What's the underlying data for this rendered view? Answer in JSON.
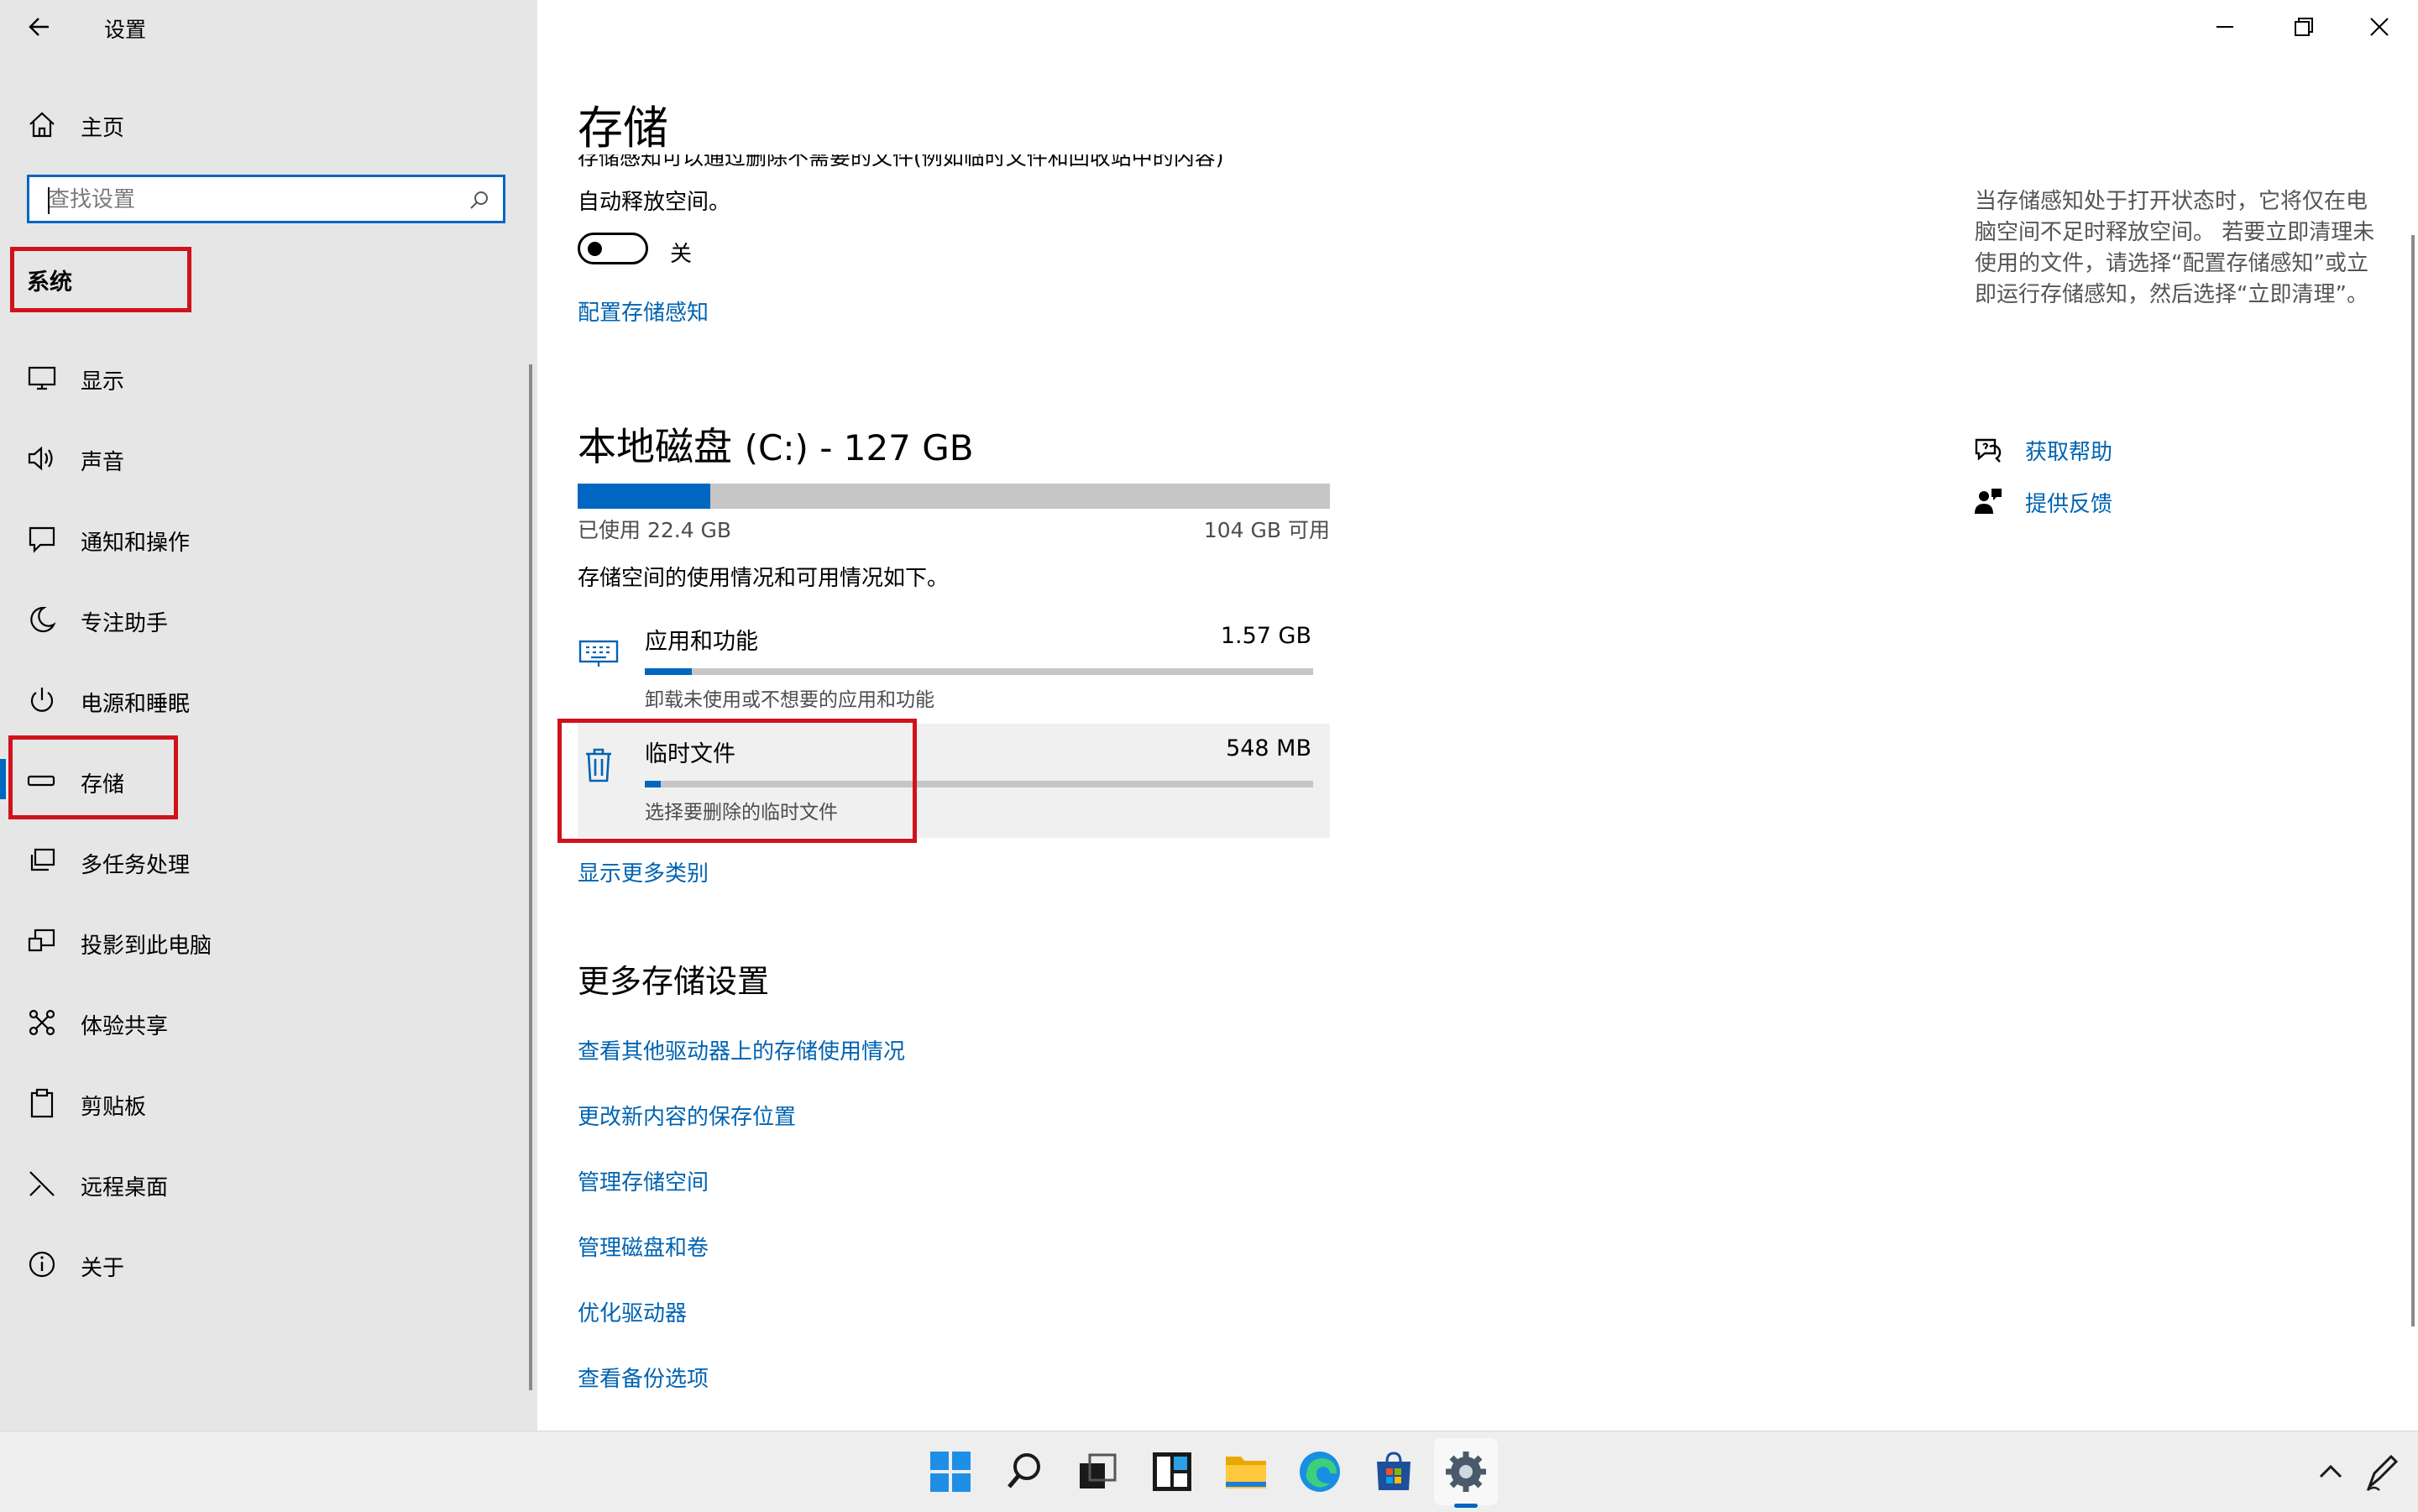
{
  "app_title": "设置",
  "home_label": "主页",
  "search": {
    "placeholder": "查找设置"
  },
  "section_header": "系统",
  "nav_items": [
    {
      "label": "显示",
      "icon": "monitor-icon"
    },
    {
      "label": "声音",
      "icon": "speaker-icon"
    },
    {
      "label": "通知和操作",
      "icon": "notification-icon"
    },
    {
      "label": "专注助手",
      "icon": "moon-icon"
    },
    {
      "label": "电源和睡眠",
      "icon": "power-icon"
    },
    {
      "label": "存储",
      "icon": "storage-icon"
    },
    {
      "label": "多任务处理",
      "icon": "multitask-icon"
    },
    {
      "label": "投影到此电脑",
      "icon": "project-icon"
    },
    {
      "label": "体验共享",
      "icon": "share-icon"
    },
    {
      "label": "剪贴板",
      "icon": "clipboard-icon"
    },
    {
      "label": "远程桌面",
      "icon": "remote-icon"
    },
    {
      "label": "关于",
      "icon": "info-icon"
    }
  ],
  "main": {
    "title": "存储",
    "cut_text": "存储感知可以通过删除不需要的文件(例如临时文件和回收站中的内容)",
    "auto_free": "自动释放空间。",
    "toggle_label": "关",
    "toggle_on": false,
    "configure_link": "配置存储感知",
    "disk": {
      "title": "本地磁盘",
      "title_suffix": "(C:) - 127 GB",
      "used_label": "已使用 22.4 GB",
      "free_label": "104 GB 可用",
      "used_fraction": 0.176
    },
    "description": "存储空间的使用情况和可用情况如下。",
    "categories": [
      {
        "name": "应用和功能",
        "size": "1.57 GB",
        "sub": "卸载未使用或不想要的应用和功能",
        "fraction": 0.07,
        "icon": "keyboard-icon"
      },
      {
        "name": "临时文件",
        "size": "548 MB",
        "sub": "选择要删除的临时文件",
        "fraction": 0.024,
        "icon": "trash-icon"
      }
    ],
    "show_more": "显示更多类别",
    "more_title": "更多存储设置",
    "more_links": [
      "查看其他驱动器上的存储使用情况",
      "更改新内容的保存位置",
      "管理存储空间",
      "管理磁盘和卷",
      "优化驱动器",
      "查看备份选项"
    ]
  },
  "right": {
    "info": "当存储感知处于打开状态时，它将仅在电脑空间不足时释放空间。 若要立即清理未使用的文件，请选择“配置存储感知”或立即运行存储感知，然后选择“立即清理”。",
    "get_help": "获取帮助",
    "feedback": "提供反馈"
  },
  "colors": {
    "accent": "#0067c0",
    "link": "#0063b1",
    "highlight": "#d0121b",
    "sidebar_bg": "#e6e6e6"
  }
}
